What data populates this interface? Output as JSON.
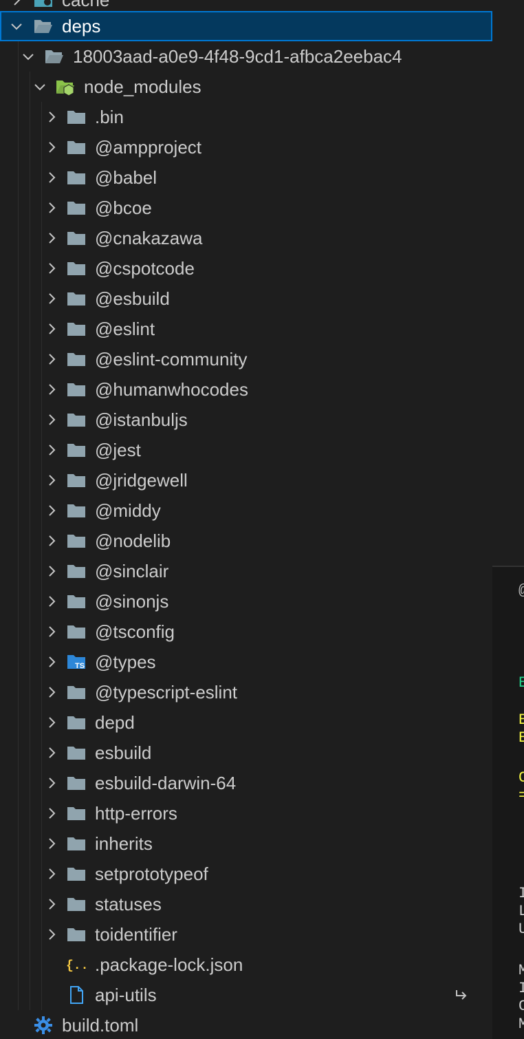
{
  "explorer": {
    "top_partial_label": "cache",
    "rows": [
      {
        "label": "deps",
        "type": "folder-open",
        "expanded": true,
        "selected": true
      },
      {
        "label": "18003aad-a0e9-4f48-9cd1-afbca2eebac4",
        "type": "folder-open",
        "expanded": true
      },
      {
        "label": "node_modules",
        "type": "folder-node",
        "expanded": true
      },
      {
        "label": ".bin",
        "type": "folder"
      },
      {
        "label": "@ampproject",
        "type": "folder"
      },
      {
        "label": "@babel",
        "type": "folder"
      },
      {
        "label": "@bcoe",
        "type": "folder"
      },
      {
        "label": "@cnakazawa",
        "type": "folder"
      },
      {
        "label": "@cspotcode",
        "type": "folder"
      },
      {
        "label": "@esbuild",
        "type": "folder"
      },
      {
        "label": "@eslint",
        "type": "folder"
      },
      {
        "label": "@eslint-community",
        "type": "folder"
      },
      {
        "label": "@humanwhocodes",
        "type": "folder"
      },
      {
        "label": "@istanbuljs",
        "type": "folder"
      },
      {
        "label": "@jest",
        "type": "folder"
      },
      {
        "label": "@jridgewell",
        "type": "folder"
      },
      {
        "label": "@middy",
        "type": "folder"
      },
      {
        "label": "@nodelib",
        "type": "folder"
      },
      {
        "label": "@sinclair",
        "type": "folder"
      },
      {
        "label": "@sinonjs",
        "type": "folder"
      },
      {
        "label": "@tsconfig",
        "type": "folder"
      },
      {
        "label": "@types",
        "type": "folder-ts"
      },
      {
        "label": "@typescript-eslint",
        "type": "folder"
      },
      {
        "label": "depd",
        "type": "folder"
      },
      {
        "label": "esbuild",
        "type": "folder"
      },
      {
        "label": "esbuild-darwin-64",
        "type": "folder"
      },
      {
        "label": "http-errors",
        "type": "folder"
      },
      {
        "label": "inherits",
        "type": "folder"
      },
      {
        "label": "setprototypeof",
        "type": "folder"
      },
      {
        "label": "statuses",
        "type": "folder"
      },
      {
        "label": "toidentifier",
        "type": "folder"
      },
      {
        "label": ".package-lock.json",
        "type": "json"
      },
      {
        "label": "api-utils",
        "type": "file-link"
      },
      {
        "label": "build.toml",
        "type": "gear"
      }
    ]
  },
  "colors": {
    "selection_bg": "#04395e",
    "selection_border": "#0078d4",
    "folder": "#90a4ae",
    "node_folder": "#8bc34a",
    "ts_folder": "#2d87d8",
    "json_icon": "#f5c842",
    "file_icon": "#42a5f5",
    "gear_icon": "#3a8ee6"
  },
  "right_panel": {
    "fragments": [
      {
        "text": "@",
        "color": "#bbbbbb"
      },
      {
        "text": "E",
        "color": "#23d18b"
      },
      {
        "text": "E",
        "color": "#f5f543"
      },
      {
        "text": "E",
        "color": "#f5f543"
      },
      {
        "text": "C",
        "color": "#f5f543"
      },
      {
        "text": "=",
        "color": "#f5f543"
      },
      {
        "text": "I",
        "color": "#cccccc"
      },
      {
        "text": "L",
        "color": "#cccccc"
      },
      {
        "text": "U",
        "color": "#cccccc"
      },
      {
        "text": "M",
        "color": "#cccccc"
      },
      {
        "text": "I",
        "color": "#cccccc"
      },
      {
        "text": "C",
        "color": "#cccccc"
      },
      {
        "text": "M",
        "color": "#cccccc"
      }
    ]
  }
}
